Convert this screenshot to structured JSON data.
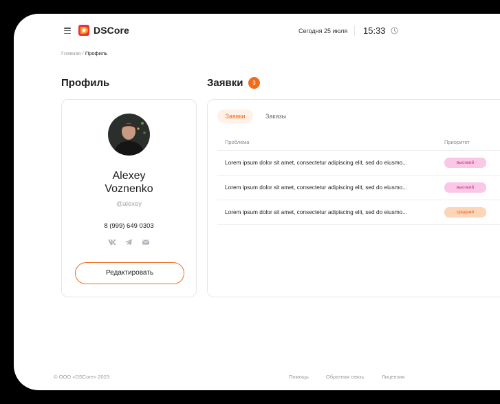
{
  "header": {
    "logo_text": "DSCore",
    "date": "Сегодня 25 июля",
    "time": "15:33"
  },
  "breadcrumb": {
    "home": "Главная",
    "separator": " / ",
    "current": "Профиль"
  },
  "profile": {
    "title": "Профиль",
    "first_name": "Alexey",
    "last_name": "Voznenko",
    "handle": "@alexey",
    "phone": "8 (999) 649 0303",
    "socials": [
      "vk-icon",
      "telegram-icon",
      "mail-icon"
    ],
    "edit_button": "Редактировать"
  },
  "requests": {
    "title": "Заявки",
    "count": "3",
    "tabs": [
      {
        "label": "Заявки",
        "active": true
      },
      {
        "label": "Заказы",
        "active": false
      }
    ],
    "columns": {
      "problem": "Проблема",
      "priority": "Приоритет"
    },
    "rows": [
      {
        "problem": "Lorem ipsum dolor sit amet, consectetur adipiscing elit, sed do eiusmo...",
        "priority": "высокий"
      },
      {
        "problem": "Lorem ipsum dolor sit amet, consectetur adipiscing elit, sed do eiusmo...",
        "priority": "высокий"
      },
      {
        "problem": "Lorem ipsum dolor sit amet, consectetur adipiscing elit, sed do eiusmo...",
        "priority": "средний"
      }
    ]
  },
  "footer": {
    "copyright": "© ООО «DSCore» 2023",
    "links": [
      "Помощь",
      "Обратная связь",
      "Лицензия"
    ]
  },
  "colors": {
    "accent": "#f26b1d",
    "priority_high_bg": "#fbc7e6",
    "priority_mid_bg": "#fdd5b8"
  }
}
